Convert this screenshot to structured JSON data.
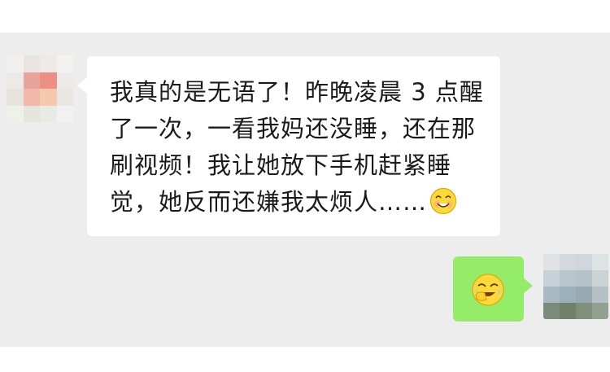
{
  "messages": [
    {
      "from": "other",
      "lines": [
        "我真的是无语了！昨晚凌晨 3 点醒",
        "了一次，一看我妈还没睡，还在那",
        "刷视频！我让她放下手机赶紧睡",
        "觉，她反而还嫌我太烦人……"
      ],
      "trailing_emoji": "awkward-smile-emoji"
    },
    {
      "from": "me",
      "emoji": "facepalm-laugh-emoji"
    }
  ],
  "colors": {
    "chat_background": "#ededed",
    "incoming_bubble": "#ffffff",
    "outgoing_bubble": "#95ec69"
  }
}
